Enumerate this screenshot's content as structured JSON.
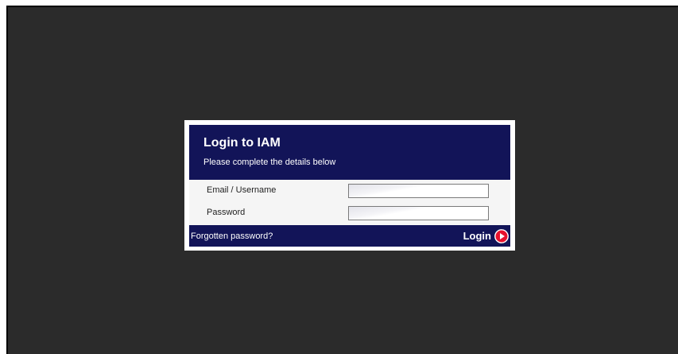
{
  "dialog": {
    "title": "Login to IAM",
    "subtitle": "Please complete the details below"
  },
  "form": {
    "email_label": "Email / Username",
    "email_value": "",
    "password_label": "Password",
    "password_value": ""
  },
  "footer": {
    "forgot_label": "Forgotten password?",
    "login_label": "Login",
    "login_icon": "play-circle-icon"
  },
  "colors": {
    "screen_background": "#2b2b2b",
    "header_background": "#121458",
    "accent_red": "#e8112d"
  }
}
